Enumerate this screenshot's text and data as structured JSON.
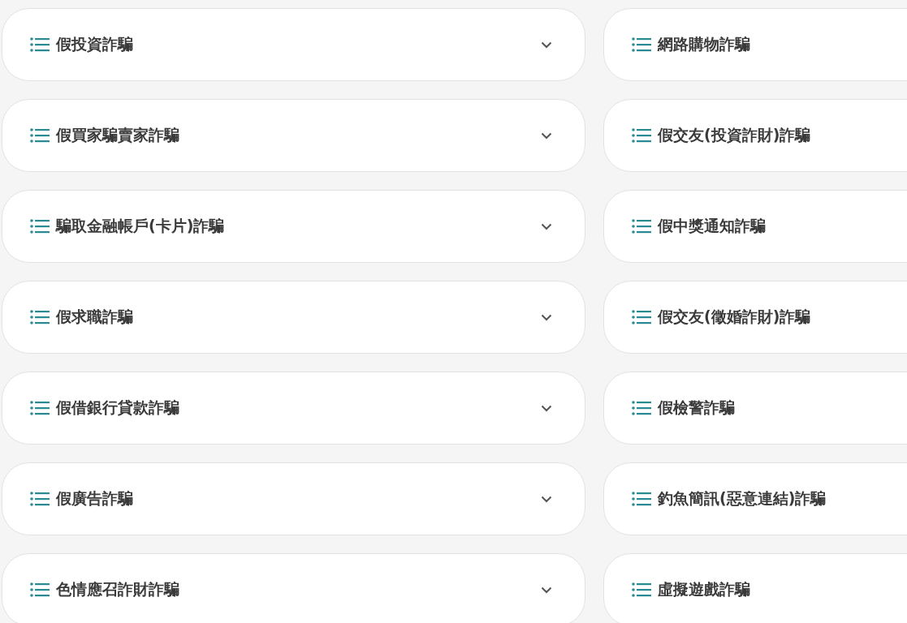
{
  "left_column": [
    {
      "title": "假投資詐騙",
      "expanded": false
    },
    {
      "title": "假買家騙賣家詐騙",
      "expanded": false
    },
    {
      "title": "騙取金融帳戶(卡片)詐騙",
      "expanded": false
    },
    {
      "title": "假求職詐騙",
      "expanded": false
    },
    {
      "title": "假借銀行貸款詐騙",
      "expanded": false
    },
    {
      "title": "假廣告詐騙",
      "expanded": false
    },
    {
      "title": "色情應召詐財詐騙",
      "expanded": false
    }
  ],
  "right_column": [
    {
      "title": "網路購物詐騙"
    },
    {
      "title": "假交友(投資詐財)詐騙"
    },
    {
      "title": "假中獎通知詐騙"
    },
    {
      "title": "假交友(徵婚詐財)詐騙"
    },
    {
      "title": "假檢警詐騙"
    },
    {
      "title": "釣魚簡訊(惡意連結)詐騙"
    },
    {
      "title": "虛擬遊戲詐騙"
    }
  ]
}
